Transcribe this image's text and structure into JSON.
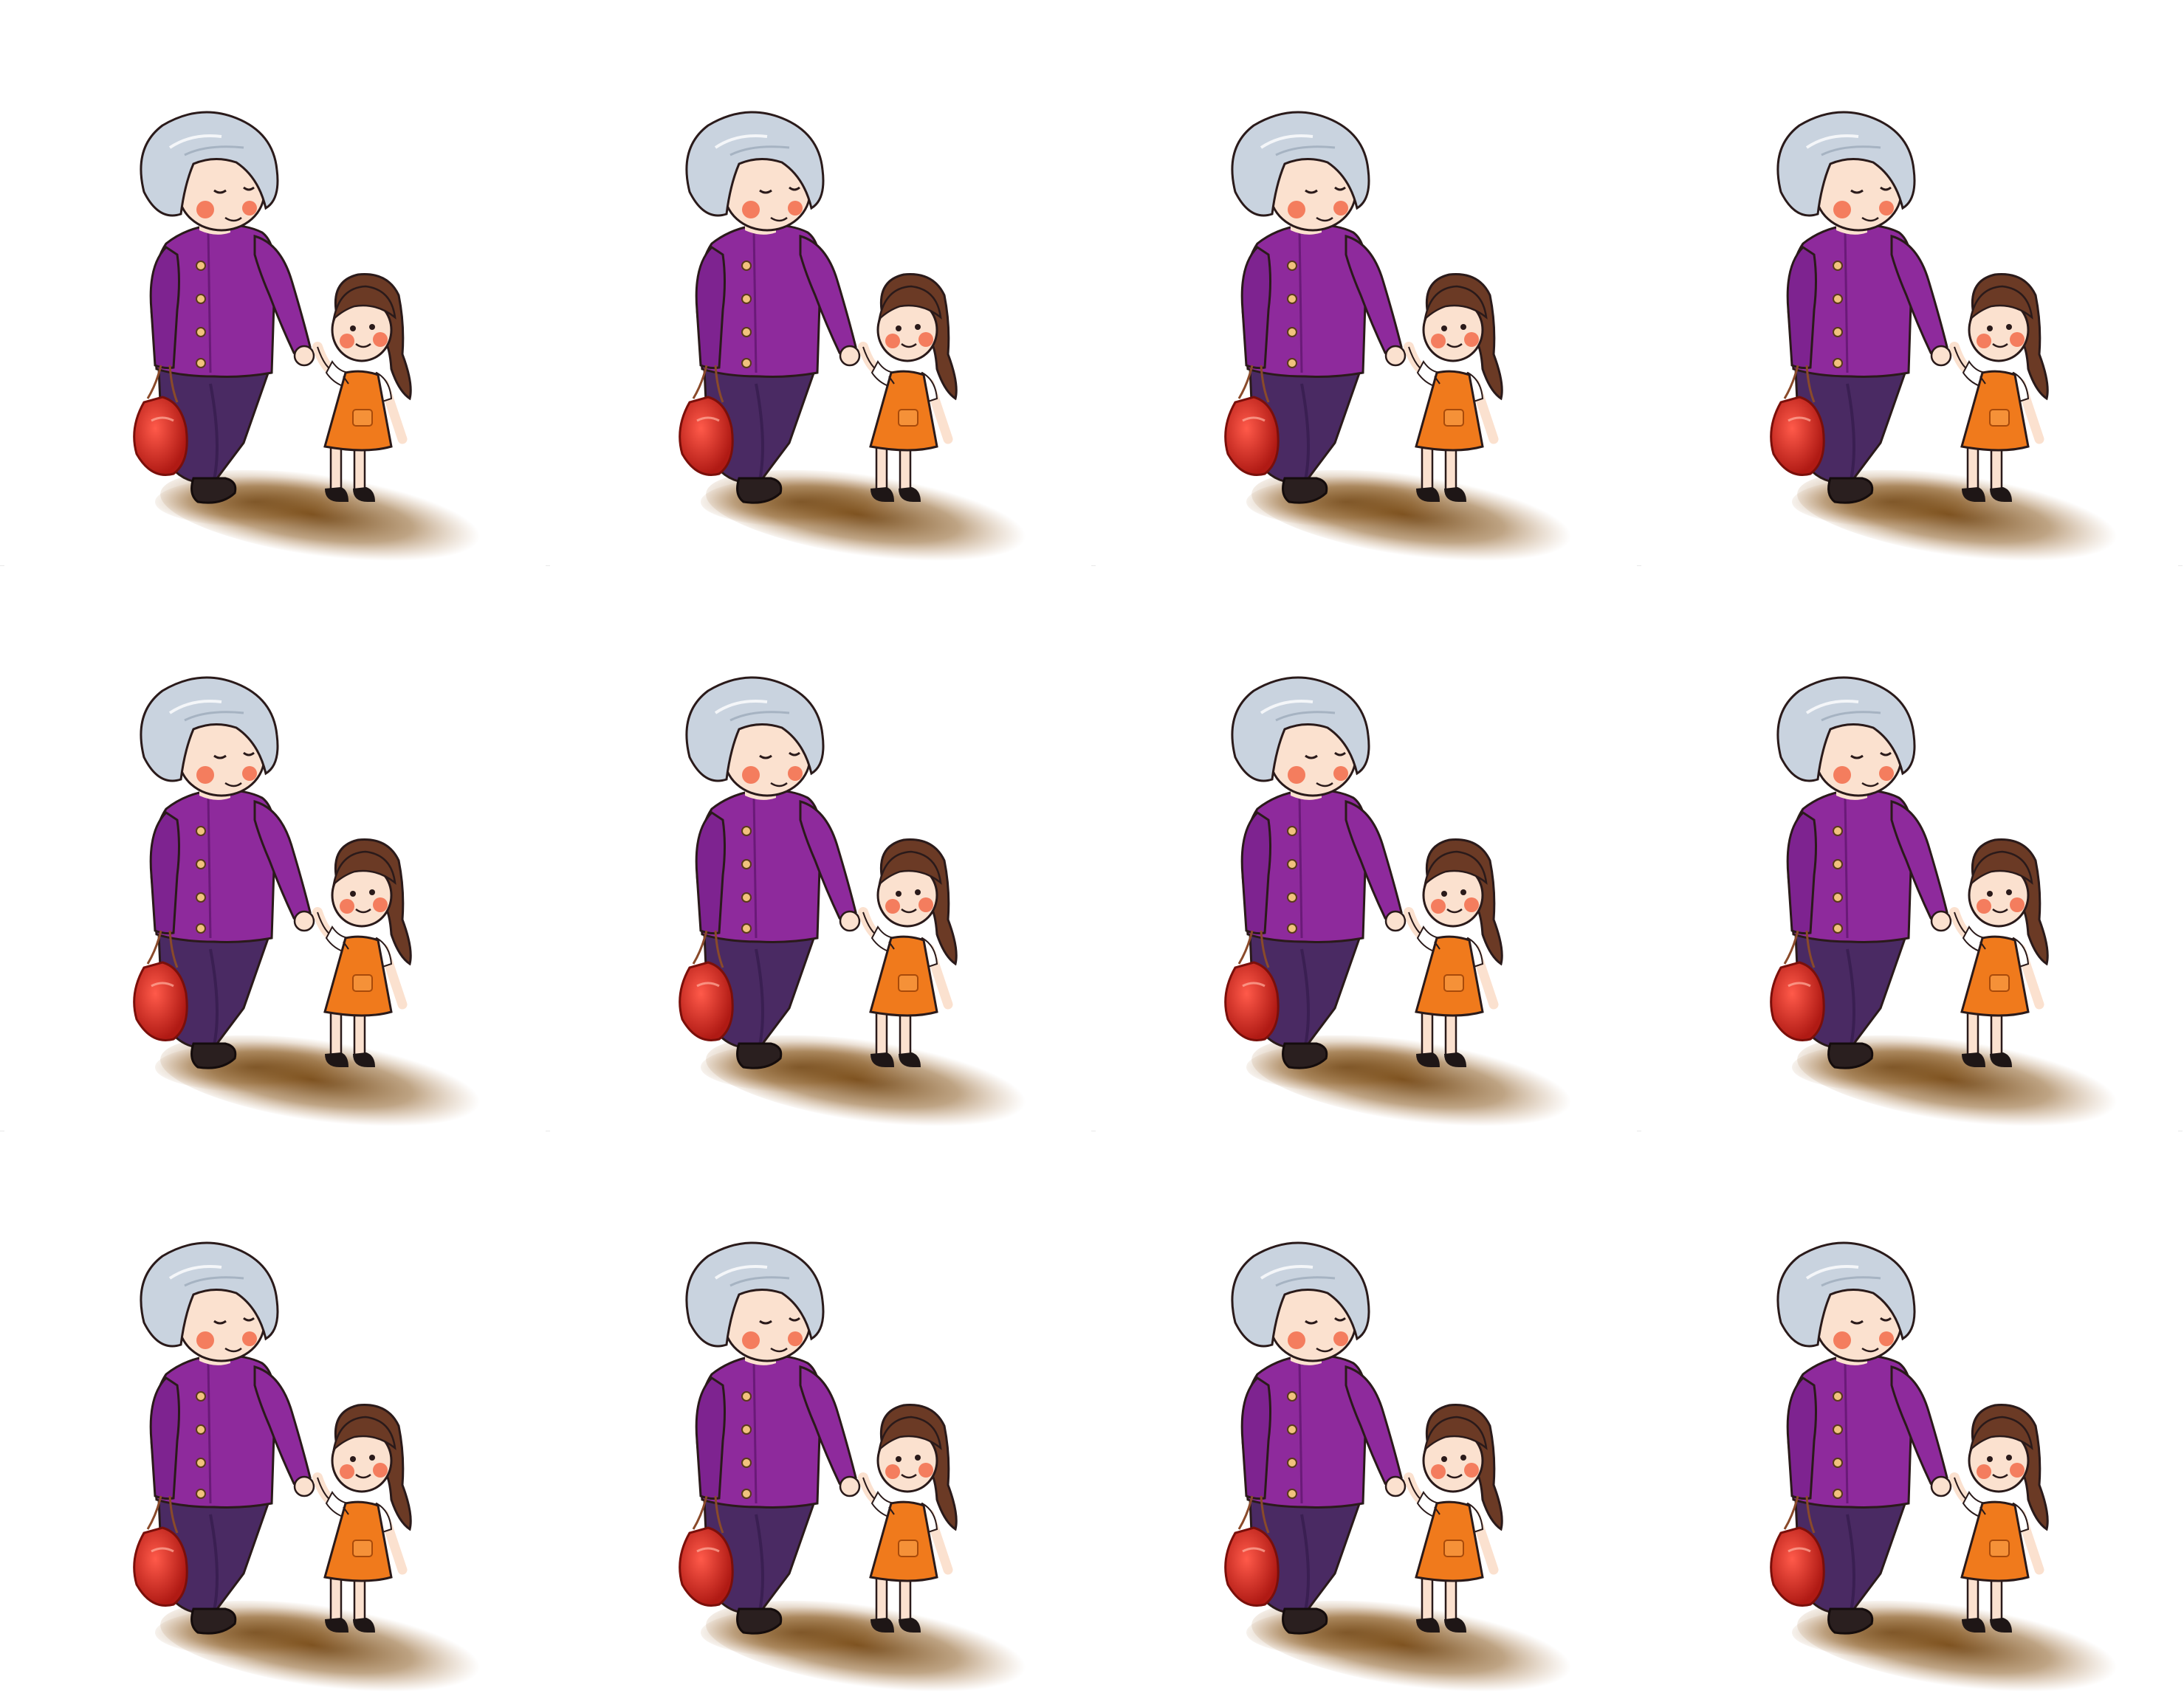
{
  "sheet": {
    "rows": 3,
    "columns": 4,
    "tile": "grandmother-walking-with-girl-illustration"
  },
  "colors": {
    "background": "#ffffff",
    "grandma_hair": "#c9d3df",
    "grandma_cardigan": "#8e2a9c",
    "grandma_pants": "#4a2a63",
    "bag": "#d8261f",
    "girl_hair": "#6b3a25",
    "girl_dress": "#f07a1c",
    "skin": "#fbe1cf",
    "cheeks": "#f26b4a",
    "shadow": "#7a4a14",
    "outline": "#2a1a1a"
  }
}
